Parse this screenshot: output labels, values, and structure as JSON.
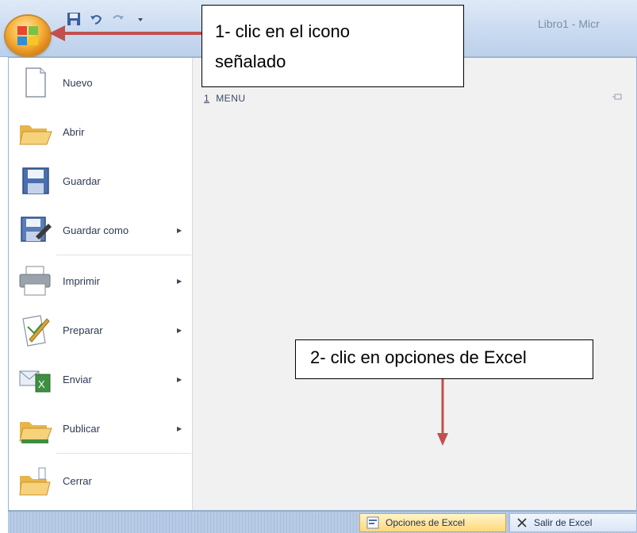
{
  "title_bar": {
    "document_title": "Libro1 - Micr"
  },
  "menu": {
    "items": [
      {
        "label": "Nuevo",
        "has_arrow": false
      },
      {
        "label": "Abrir",
        "has_arrow": false
      },
      {
        "label": "Guardar",
        "has_arrow": false
      },
      {
        "label": "Guardar como",
        "has_arrow": true
      },
      {
        "label": "Imprimir",
        "has_arrow": true
      },
      {
        "label": "Preparar",
        "has_arrow": true
      },
      {
        "label": "Enviar",
        "has_arrow": true
      },
      {
        "label": "Publicar",
        "has_arrow": true
      },
      {
        "label": "Cerrar",
        "has_arrow": false
      }
    ],
    "recent": {
      "number": "1",
      "label": "MENU"
    }
  },
  "bottom_bar": {
    "options_label": "Opciones de Excel",
    "exit_label": "Salir de Excel"
  },
  "callouts": {
    "step1_line1": "1- clic en el icono",
    "step1_line2": "señalado",
    "step2": "2- clic en opciones de Excel"
  },
  "colors": {
    "arrow": "#c0504d",
    "office_button": "#f6b13b",
    "options_highlight": "#ffd87a"
  }
}
